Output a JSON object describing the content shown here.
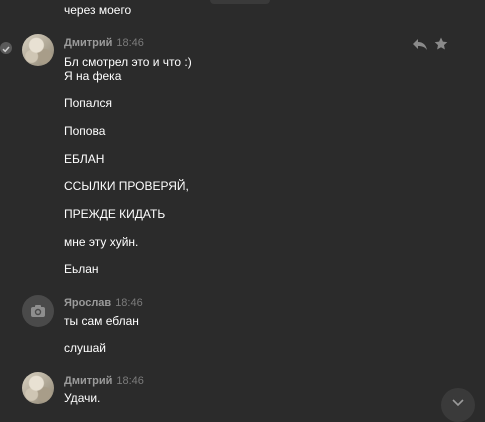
{
  "chat": {
    "messages": [
      {
        "text": "через моего"
      }
    ],
    "groups": [
      {
        "author": "Дмитрий",
        "time": "18:46",
        "messages": [
          "Бл смотрел это и что :)",
          "Я на фека",
          "Попался",
          "Попова",
          "ЕБЛАН",
          "ССЫЛКИ ПРОВЕРЯЙ,",
          "ПРЕЖДЕ КИДАТЬ",
          "мне эту хуйн.",
          "Еьлан"
        ]
      },
      {
        "author": "Ярослав",
        "time": "18:46",
        "messages": [
          "ты сам еблан",
          "слушай"
        ]
      },
      {
        "author": "Дмитрий",
        "time": "18:46",
        "messages": [
          "Удачи."
        ]
      }
    ]
  },
  "icons": {
    "read": "check-icon",
    "reply": "reply-icon",
    "favorite": "star-icon",
    "camera": "camera-icon",
    "scroll_down": "chevron-down-icon"
  },
  "colors": {
    "background": "#2b2b2b",
    "text": "#ffffff",
    "author": "#9a9a9a",
    "time": "#7b7b7b"
  }
}
